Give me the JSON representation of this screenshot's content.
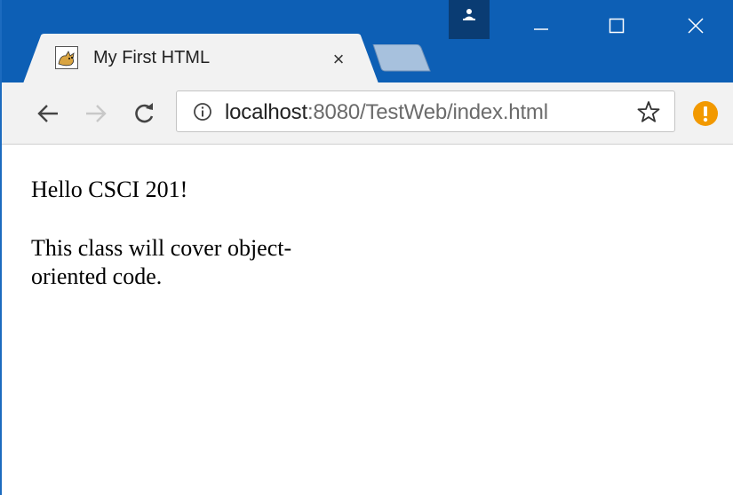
{
  "window": {
    "tab": {
      "title": "My First HTML",
      "close_glyph": "×",
      "favicon": "tomcat-icon"
    },
    "controls": {
      "minimize": "minimize-icon",
      "maximize": "maximize-icon",
      "close": "close-icon",
      "profile": "person-icon"
    }
  },
  "toolbar": {
    "back": "arrow-left-icon",
    "forward": "arrow-right-icon",
    "reload": "reload-icon",
    "omnibox": {
      "host": "localhost",
      "path": ":8080/TestWeb/index.html",
      "info_icon": "info-icon",
      "bookmark_icon": "star-icon"
    },
    "extension_icon": "alert-icon"
  },
  "page": {
    "paragraph1": "Hello CSCI 201!",
    "paragraph2": "This class will cover object-oriented code."
  },
  "colors": {
    "titlebar": "#0d5fb5",
    "profile_button": "#0a3c73",
    "toolbar": "#f2f2f2",
    "extension_badge": "#f29900"
  }
}
